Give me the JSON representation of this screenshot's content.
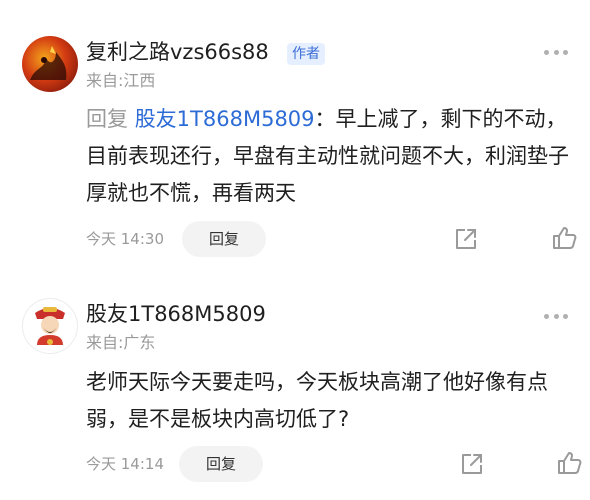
{
  "comments": [
    {
      "username": "复利之路vzs66s88",
      "badge": "作者",
      "location": "来自:江西",
      "reply_prefix": "回复 ",
      "reply_target": "股友1T868M5809",
      "reply_separator": "：",
      "text": "早上减了，剩下的不动，目前表现还行，早盘有主动性就问题不大，利润垫子厚就也不慌，再看两天",
      "time": "今天 14:30",
      "reply_label": "回复",
      "avatar_icon": "flame-avatar-icon"
    },
    {
      "username": "股友1T868M5809",
      "location": "来自:广东",
      "text": "老师天际今天要走吗，今天板块高潮了他好像有点弱，是不是板块内高切低了?",
      "time": "今天 14:14",
      "reply_label": "回复",
      "avatar_icon": "caishen-avatar-icon"
    }
  ],
  "colors": {
    "accent": "#2d6bd6",
    "badge_bg": "#e6efff",
    "badge_text": "#3d6fd6",
    "muted": "#9a9a9a"
  },
  "icons": [
    "more-icon",
    "share-icon",
    "like-icon"
  ]
}
